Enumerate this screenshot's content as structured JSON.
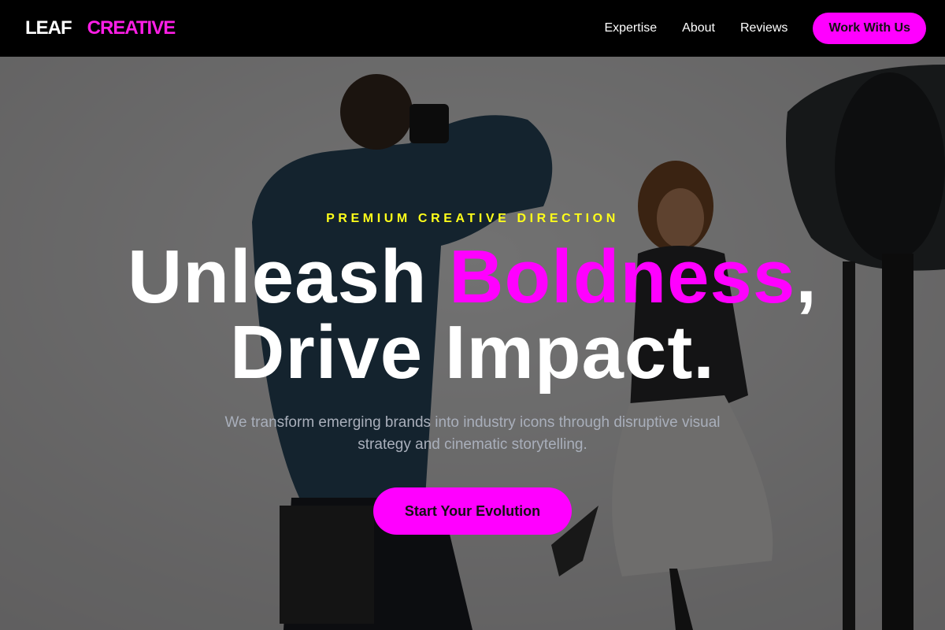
{
  "brand": {
    "part1": "LEAF",
    "part2": "CREATIVE"
  },
  "nav": {
    "links": [
      "Expertise",
      "About",
      "Reviews"
    ],
    "cta": "Work With Us"
  },
  "hero": {
    "eyebrow": "PREMIUM CREATIVE DIRECTION",
    "headline": {
      "before": "Unleash ",
      "accent": "Boldness",
      "after": ",",
      "line2": "Drive Impact."
    },
    "subtitle": "We transform emerging brands into industry icons through disruptive visual strategy and cinematic storytelling.",
    "cta": "Start Your Evolution",
    "background_image": "photo-shoot-studio-scene"
  },
  "colors": {
    "accent": "#ff00ff",
    "eyebrow": "#ffff1a",
    "nav_bg": "#000000",
    "subtitle": "#a9afbb"
  }
}
